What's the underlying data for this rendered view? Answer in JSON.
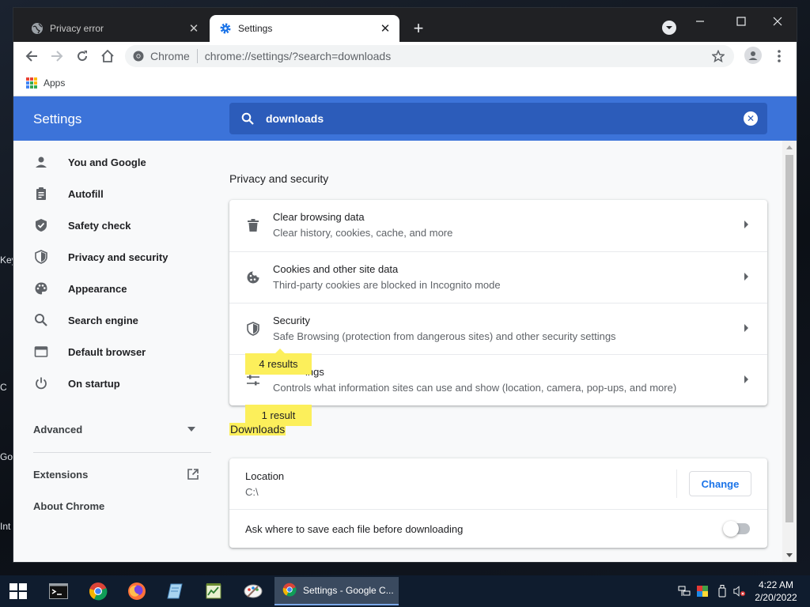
{
  "desktop": {
    "edge_texts": [
      "Key",
      "C",
      "Go",
      "Int"
    ]
  },
  "tabs": [
    {
      "title": "Privacy error",
      "icon": "globe-icon",
      "active": false
    },
    {
      "title": "Settings",
      "icon": "gear-icon",
      "active": true
    }
  ],
  "omnibox": {
    "scheme_label": "Chrome",
    "url": "chrome://settings/?search=downloads"
  },
  "bookmarks": {
    "apps_label": "Apps"
  },
  "settings": {
    "title": "Settings",
    "search_value": "downloads"
  },
  "sidebar": {
    "items": [
      {
        "label": "You and Google",
        "icon": "person-icon"
      },
      {
        "label": "Autofill",
        "icon": "clipboard-icon"
      },
      {
        "label": "Safety check",
        "icon": "shield-check-icon"
      },
      {
        "label": "Privacy and security",
        "icon": "shield-icon"
      },
      {
        "label": "Appearance",
        "icon": "palette-icon"
      },
      {
        "label": "Search engine",
        "icon": "search-icon"
      },
      {
        "label": "Default browser",
        "icon": "browser-icon"
      },
      {
        "label": "On startup",
        "icon": "power-icon"
      }
    ],
    "advanced_label": "Advanced",
    "extensions_label": "Extensions",
    "about_label": "About Chrome"
  },
  "privacy_section": {
    "title": "Privacy and security",
    "results_bubble": "4 results",
    "rows": [
      {
        "title": "Clear browsing data",
        "subtitle": "Clear history, cookies, cache, and more",
        "icon": "trash-icon"
      },
      {
        "title": "Cookies and other site data",
        "subtitle": "Third-party cookies are blocked in Incognito mode",
        "icon": "cookie-icon"
      },
      {
        "title": "Security",
        "subtitle": "Safe Browsing (protection from dangerous sites) and other security settings",
        "icon": "shield-icon"
      },
      {
        "title": "ings",
        "subtitle": "Controls what information sites can use and show (location, camera, pop-ups, and more)",
        "icon": "sliders-icon"
      }
    ]
  },
  "downloads_section": {
    "results_bubble": "1 result",
    "title": "Downloads",
    "location_label": "Location",
    "location_value": "C:\\",
    "change_label": "Change",
    "ask_label": "Ask where to save each file before downloading",
    "ask_enabled": false
  },
  "taskbar": {
    "active_window_label": "Settings - Google C...",
    "time": "4:22 AM",
    "date": "2/20/2022"
  },
  "colors": {
    "header_blue": "#3c73d9",
    "search_blue": "#2c5cba",
    "highlight_yellow": "#fcef5b",
    "link_blue": "#1a73e8"
  }
}
